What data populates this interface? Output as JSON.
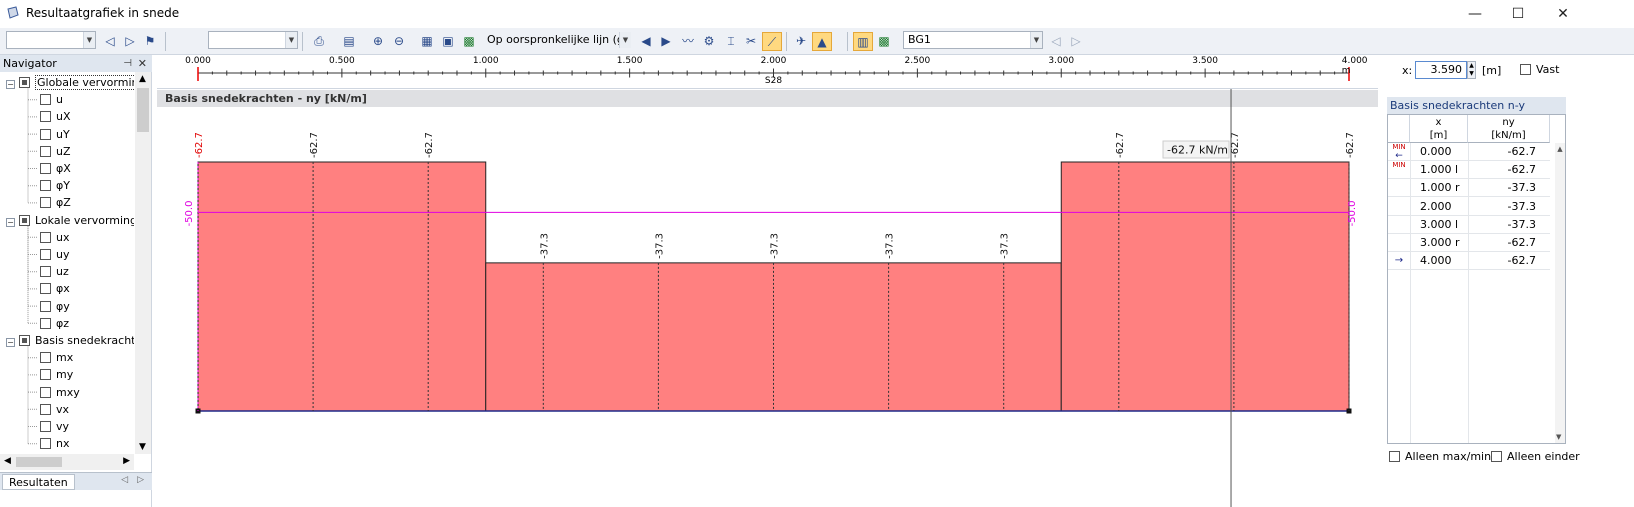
{
  "window": {
    "title": "Resultaatgrafiek in snede",
    "controls": {
      "minimize": "—",
      "maximize": "☐",
      "close": "✕"
    }
  },
  "toolbar": {
    "combo1_value": "",
    "combo2_value": "",
    "line_combo_value": "Op oorspronkelijke lijn (gr",
    "loadcase_value": "BG1",
    "icons": [
      "nav-back-icon",
      "nav-forward-icon",
      "filter-icon",
      "print-icon",
      "export-icon",
      "zoom-in-icon",
      "zoom-out-icon",
      "graph-icon",
      "save-icon",
      "excel-icon",
      "prev-icon",
      "next-icon",
      "smooth-icon",
      "settings-icon",
      "section-icon",
      "cut-icon",
      "line-result-icon",
      "view-icon",
      "result-icon",
      "table-icon",
      "value-icon"
    ]
  },
  "navigator": {
    "title": "Navigator",
    "pin": "⊣",
    "close": "✕",
    "items": [
      {
        "label": "Globale vervormin",
        "level": 0,
        "checked": "partial",
        "selected": true
      },
      {
        "label": "u",
        "level": 1,
        "checked": false
      },
      {
        "label": "uX",
        "level": 1,
        "checked": false
      },
      {
        "label": "uY",
        "level": 1,
        "checked": false
      },
      {
        "label": "uZ",
        "level": 1,
        "checked": false
      },
      {
        "label": "φX",
        "level": 1,
        "checked": false
      },
      {
        "label": "φY",
        "level": 1,
        "checked": false
      },
      {
        "label": "φZ",
        "level": 1,
        "checked": false
      },
      {
        "label": "Lokale vervorming",
        "level": 0,
        "checked": "partial"
      },
      {
        "label": "ux",
        "level": 1,
        "checked": false
      },
      {
        "label": "uy",
        "level": 1,
        "checked": false
      },
      {
        "label": "uz",
        "level": 1,
        "checked": false
      },
      {
        "label": "φx",
        "level": 1,
        "checked": false
      },
      {
        "label": "φy",
        "level": 1,
        "checked": false
      },
      {
        "label": "φz",
        "level": 1,
        "checked": false
      },
      {
        "label": "Basis snedekrachte",
        "level": 0,
        "checked": "partial"
      },
      {
        "label": "mx",
        "level": 1,
        "checked": false
      },
      {
        "label": "my",
        "level": 1,
        "checked": false
      },
      {
        "label": "mxy",
        "level": 1,
        "checked": false
      },
      {
        "label": "vx",
        "level": 1,
        "checked": false
      },
      {
        "label": "vy",
        "level": 1,
        "checked": false
      },
      {
        "label": "nx",
        "level": 1,
        "checked": false
      }
    ],
    "tab_label": "Resultaten"
  },
  "ruler": {
    "ticks": [
      "0.000",
      "0.500",
      "1.000",
      "1.500",
      "2.000",
      "2.500",
      "3.000",
      "3.500",
      "4.000 m"
    ],
    "section_name": "S28"
  },
  "position": {
    "x_label": "x:",
    "x_value": "3.590",
    "unit": "[m]",
    "fixed_label": "Vast"
  },
  "chart_header": "Basis snedekrachten - ny [kN/m]",
  "chart_data": {
    "type": "area",
    "title": "Basis snedekrachten - ny [kN/m]",
    "x_unit": "m",
    "y_unit": "kN/m",
    "xlim": [
      0,
      4
    ],
    "segments": [
      {
        "x_start": 0,
        "x_end": 1,
        "value": -62.7
      },
      {
        "x_start": 1,
        "x_end": 3,
        "value": -37.3
      },
      {
        "x_start": 3,
        "x_end": 4,
        "value": -62.7
      }
    ],
    "value_labels": [
      {
        "x": 0.0,
        "value": "-62.7",
        "min": true
      },
      {
        "x": 0.4,
        "value": "-62.7"
      },
      {
        "x": 0.8,
        "value": "-62.7"
      },
      {
        "x": 1.2,
        "value": "-37.3"
      },
      {
        "x": 1.6,
        "value": "-37.3"
      },
      {
        "x": 2.0,
        "value": "-37.3"
      },
      {
        "x": 2.4,
        "value": "-37.3"
      },
      {
        "x": 2.8,
        "value": "-37.3"
      },
      {
        "x": 3.2,
        "value": "-62.7"
      },
      {
        "x": 3.6,
        "value": "-62.7"
      },
      {
        "x": 4.0,
        "value": "-62.7"
      }
    ],
    "reference_line": {
      "value": -50.0,
      "label": "-50.0",
      "color": "#e000e0"
    },
    "cursor": {
      "x": 3.59,
      "tooltip": "-62.7 kN/m"
    },
    "fill_color": "#ff8080",
    "min_label_color": "#e00000"
  },
  "result_table": {
    "title": "Basis snedekrachten n-y",
    "col_x": "x",
    "col_x_unit": "[m]",
    "col_y": "ny",
    "col_y_unit": "[kN/m]",
    "rows": [
      {
        "marker": "MIN",
        "x": "0.000",
        "value": "-62.7"
      },
      {
        "marker": "MIN",
        "x": "1.000 l",
        "value": "-62.7"
      },
      {
        "marker": "",
        "x": "1.000 r",
        "value": "-37.3"
      },
      {
        "marker": "",
        "x": "2.000",
        "value": "-37.3"
      },
      {
        "marker": "",
        "x": "3.000 l",
        "value": "-37.3"
      },
      {
        "marker": "",
        "x": "3.000 r",
        "value": "-62.7"
      },
      {
        "marker": "",
        "x": "4.000",
        "value": "-62.7"
      }
    ],
    "only_maxmin": "Alleen max/min",
    "only_ends": "Alleen einder"
  }
}
